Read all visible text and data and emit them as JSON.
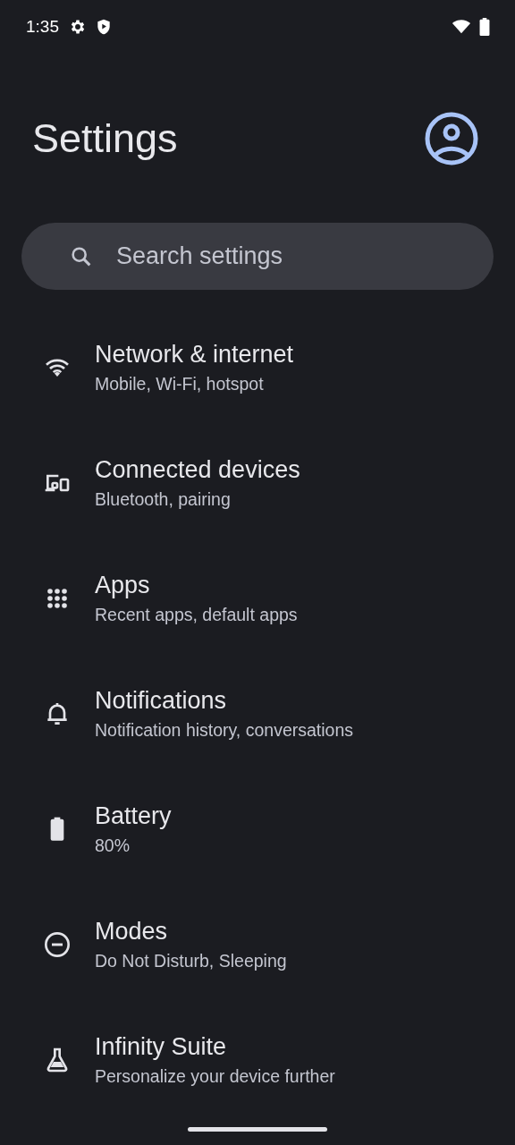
{
  "status_bar": {
    "time": "1:35"
  },
  "header": {
    "title": "Settings"
  },
  "search": {
    "placeholder": "Search settings"
  },
  "items": [
    {
      "title": "Network & internet",
      "subtitle": "Mobile, Wi‑Fi, hotspot"
    },
    {
      "title": "Connected devices",
      "subtitle": "Bluetooth, pairing"
    },
    {
      "title": "Apps",
      "subtitle": "Recent apps, default apps"
    },
    {
      "title": "Notifications",
      "subtitle": "Notification history, conversations"
    },
    {
      "title": "Battery",
      "subtitle": "80%"
    },
    {
      "title": "Modes",
      "subtitle": "Do Not Disturb, Sleeping"
    },
    {
      "title": "Infinity Suite",
      "subtitle": "Personalize your device further"
    }
  ]
}
